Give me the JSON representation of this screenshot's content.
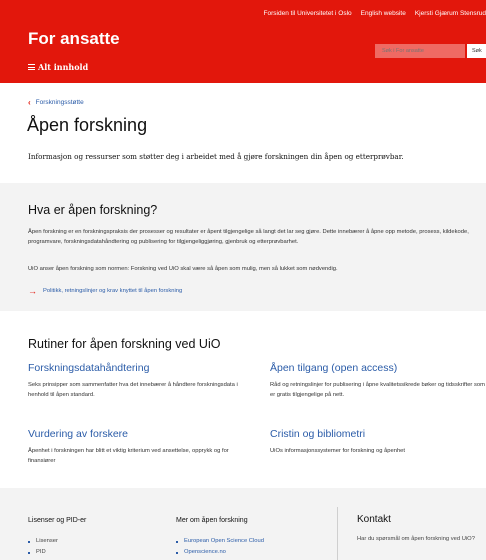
{
  "header": {
    "top_links": [
      "Forsiden til Universitetet i Oslo",
      "English website",
      "Kjersti Gjærum Stensrud"
    ],
    "site_title": "For ansatte",
    "search_placeholder": "Søk i For ansatte",
    "search_button": "Søk",
    "menu_label": "Alt innhold"
  },
  "breadcrumb": {
    "label": "Forskningsstøtte"
  },
  "page": {
    "title": "Åpen forskning",
    "intro": "Informasjon og ressurser som støtter deg i arbeidet med å gjøre forskningen din åpen og etterprøvbar."
  },
  "section1": {
    "heading": "Hva er åpen forskning?",
    "paragraph": "Åpen forskning er en forskningspraksis der prosesser og resultater er åpent tilgjengelige så langt det lar seg gjøre. Dette innebærer å åpne opp metode, prosess, kildekode, programvare, forskningsdatahåndtering og publisering for tilgjengeliggjøring, gjenbruk og etterprøvbarhet.",
    "paragraph2": "UiO anser åpen forskning som normen: Forskning ved UiO skal være så åpen som mulig, men så lukket som nødvendig.",
    "link": "Politikk, retningslinjer og krav knyttet til åpen forskning"
  },
  "section2": {
    "heading": "Rutiner for åpen forskning ved UiO",
    "cards": [
      {
        "title": "Forskningsdatahåndtering",
        "text": "Seks prinsipper som sammenfatter hva det innebærer å håndtere forskningsdata i henhold til åpen standard."
      },
      {
        "title": "Åpen tilgang (open access)",
        "text": "Råd og retningslinjer for publisering i åpne kvalitetssikrede bøker og tidsskrifter som er gratis tilgjengelige på nett."
      },
      {
        "title": "Vurdering av forskere",
        "text": "Åpenhet i forskningen har blitt et viktig kriterium ved ansettelse, opprykk og for finansiører"
      },
      {
        "title": "Cristin og bibliometri",
        "text": "UiOs informasjonssystemer for forskning og åpenhet"
      }
    ]
  },
  "footer": {
    "col1": {
      "heading": "Lisenser og PID-er",
      "items": [
        "Lisenser",
        "PID"
      ]
    },
    "col2": {
      "heading": "Mer om åpen forskning",
      "items": [
        "European Open Science Cloud",
        "Openscience.no"
      ]
    },
    "contact": {
      "heading": "Kontakt",
      "text": "Har du spørsmål om åpen forskning ved UiO?"
    }
  },
  "colors": {
    "brand_red": "#e2170c",
    "link_blue": "#2b5ca8",
    "section_gray": "#f3f3f3"
  }
}
